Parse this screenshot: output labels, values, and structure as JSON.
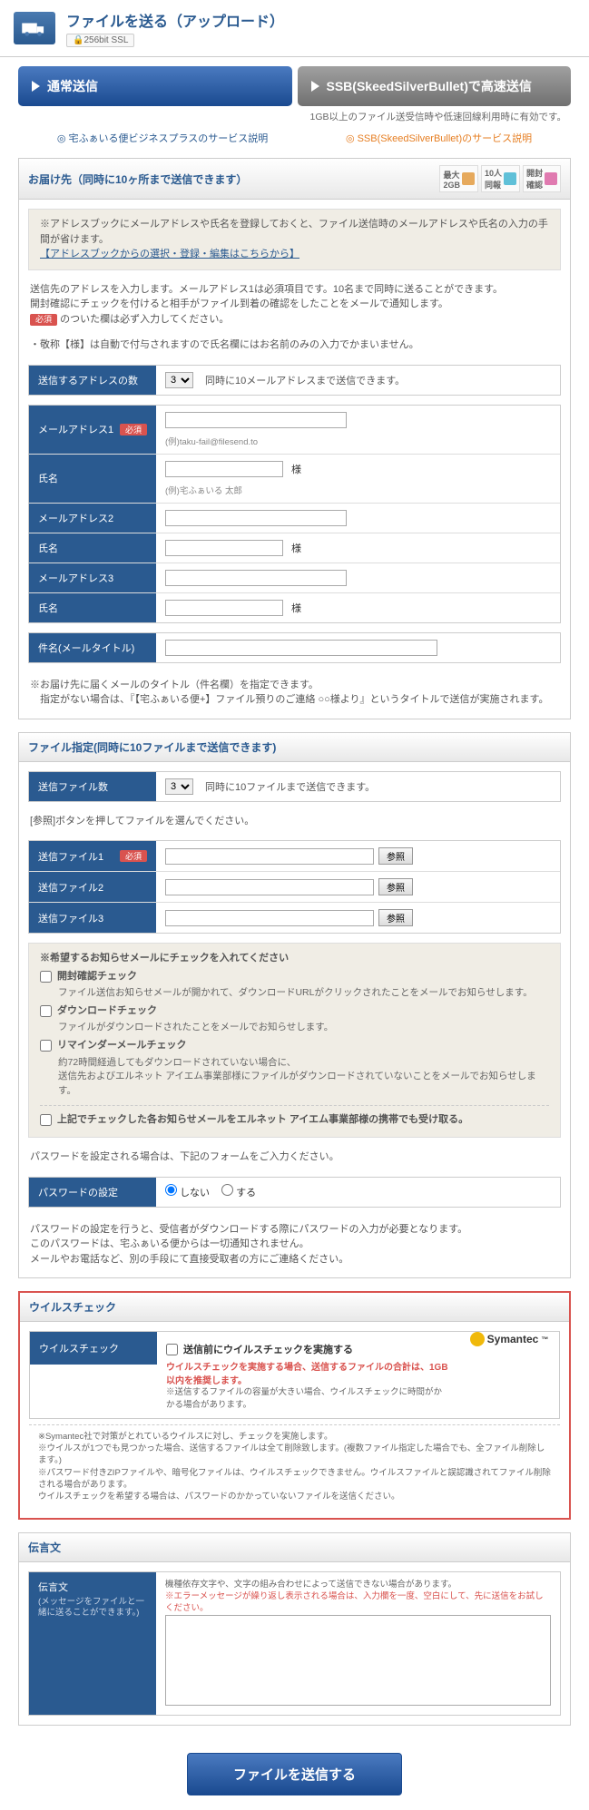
{
  "header": {
    "title": "ファイルを送る（アップロード）",
    "ssl": "256bit SSL"
  },
  "tabs": {
    "normal": "通常送信",
    "ssb": "SSB(SkeedSilverBullet)で高速送信",
    "ssb_sub": "1GB以上のファイル送受信時や低速回線利用時に有効です。"
  },
  "service_links": {
    "biz": "宅ふぁいる便ビジネスプラスのサービス説明",
    "ssb": "SSB(SkeedSilverBullet)のサービス説明"
  },
  "dest": {
    "header": "お届け先（同時に10ヶ所まで送信できます）",
    "badges": {
      "b1a": "最大",
      "b1b": "2GB",
      "b2a": "10人",
      "b2b": "同報",
      "b3a": "開封",
      "b3b": "確認"
    },
    "infobox": {
      "line1": "※アドレスブックにメールアドレスや氏名を登録しておくと、ファイル送信時のメールアドレスや氏名の入力の手間が省けます。",
      "link": "【アドレスブックからの選択・登録・編集はこちらから】"
    },
    "note1": "送信先のアドレスを入力します。メールアドレス1は必須項目です。10名まで同時に送ることができます。",
    "note2": "開封確認にチェックを付けると相手がファイル到着の確認をしたことをメールで通知します。",
    "note3_prefix": "必須",
    "note3": " のついた欄は必ず入力してください。",
    "note4": "・敬称【様】は自動で付与されますので氏名欄にはお名前のみの入力でかまいません。",
    "count_label": "送信するアドレスの数",
    "count_value": "3",
    "count_note": "同時に10メールアドレスまで送信できます。",
    "addr1": "メールアドレス1",
    "addr1_hint": "(例)taku-fail@filesend.to",
    "name_label": "氏名",
    "name_hint": "(例)宅ふぁいる 太郎",
    "suffix": "様",
    "addr2": "メールアドレス2",
    "addr3": "メールアドレス3",
    "subject_label": "件名(メールタイトル)",
    "subject_note1": "※お届け先に届くメールのタイトル（件名欄）を指定できます。",
    "subject_note2": "　指定がない場合は、『【宅ふぁいる便+】ファイル預りのご連絡 ○○様より』というタイトルで送信が実施されます。",
    "required": "必須"
  },
  "files": {
    "header": "ファイル指定(同時に10ファイルまで送信できます)",
    "count_label": "送信ファイル数",
    "count_value": "3",
    "count_note": "同時に10ファイルまで送信できます。",
    "browse_note": "[参照]ボタンを押してファイルを選んでください。",
    "file1": "送信ファイル1",
    "file2": "送信ファイル2",
    "file3": "送信ファイル3",
    "ref": "参照",
    "checks_title": "※希望するお知らせメールにチェックを入れてください",
    "chk1": "開封確認チェック",
    "chk1_desc": "ファイル送信お知らせメールが開かれて、ダウンロードURLがクリックされたことをメールでお知らせします。",
    "chk2": "ダウンロードチェック",
    "chk2_desc": "ファイルがダウンロードされたことをメールでお知らせします。",
    "chk3": "リマインダーメールチェック",
    "chk3_desc1": "約72時間経過してもダウンロードされていない場合に、",
    "chk3_desc2": "送信先およびエルネット アイエム事業部様にファイルがダウンロードされていないことをメールでお知らせします。",
    "chk4": "上記でチェックした各お知らせメールをエルネット アイエム事業部様の携帯でも受け取る。",
    "pw_intro": "パスワードを設定される場合は、下記のフォームをご入力ください。",
    "pw_label": "パスワードの設定",
    "pw_opt1": "しない",
    "pw_opt2": "する",
    "pw_note1": "パスワードの設定を行うと、受信者がダウンロードする際にパスワードの入力が必要となります。",
    "pw_note2": "このパスワードは、宅ふぁいる便からは一切通知されません。",
    "pw_note3": "メールやお電話など、別の手段にて直接受取者の方にご連絡ください。"
  },
  "virus": {
    "header": "ウイルスチェック",
    "label": "ウイルスチェック",
    "chk": "送信前にウイルスチェックを実施する",
    "red": "ウイルスチェックを実施する場合、送信するファイルの合計は、1GB以内を推奨します。",
    "small": "※送信するファイルの容量が大きい場合、ウイルスチェックに時間がかかる場合があります。",
    "sym": "Symantec",
    "n1": "※Symantec社で対策がとれているウイルスに対し、チェックを実施します。",
    "n2": "※ウイルスが1つでも見つかった場合、送信するファイルは全て削除致します。(複数ファイル指定した場合でも、全ファイル削除します。)",
    "n3": "※パスワード付きZIPファイルや、暗号化ファイルは、ウイルスチェックできません。ウイルスファイルと誤認識されてファイル削除される場合があります。",
    "n4": "ウイルスチェックを希望する場合は、パスワードのかかっていないファイルを送信ください。"
  },
  "msg": {
    "header": "伝言文",
    "label": "伝言文",
    "sub": "(メッセージをファイルと一緒に送ることができます。)",
    "note1": "機種依存文字や、文字の組み合わせによって送信できない場合があります。",
    "note2": "※エラーメッセージが繰り返し表示される場合は、入力欄を一度、空白にして、先に送信をお試しください。"
  },
  "submit": "ファイルを送信する"
}
